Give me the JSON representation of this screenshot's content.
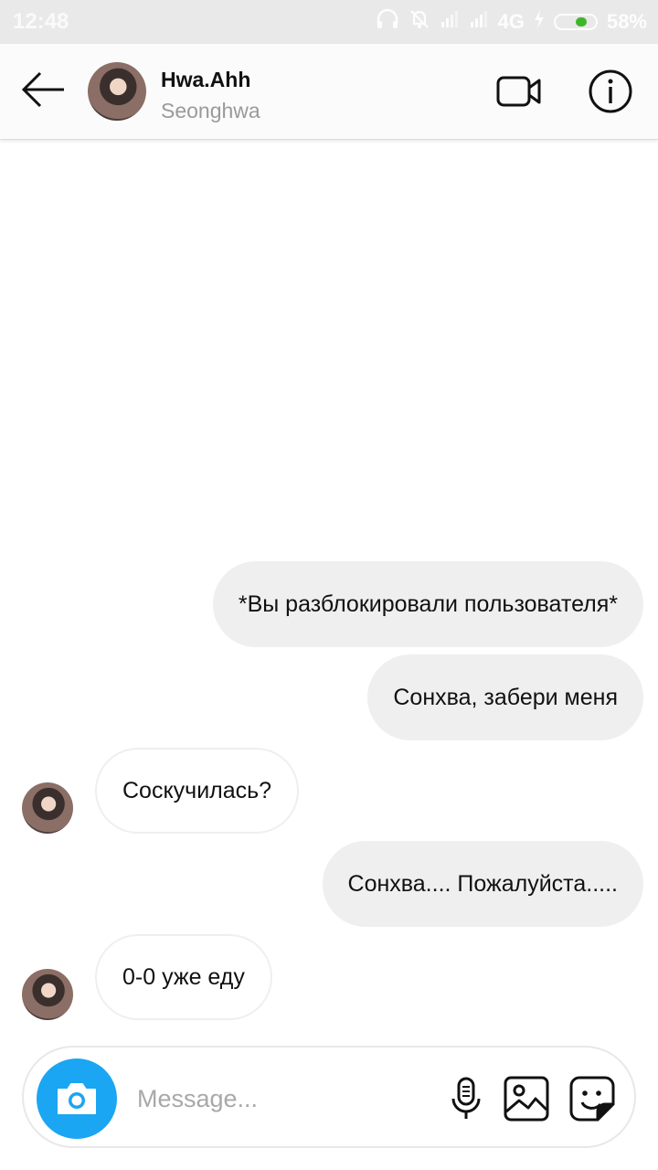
{
  "status_bar": {
    "time": "12:48",
    "network": "4G",
    "battery_percent": "58%",
    "battery_level": 0.58,
    "icons": [
      "headphones-icon",
      "bell-off-icon",
      "signal-icon",
      "signal-icon",
      "charging-icon",
      "battery-icon"
    ]
  },
  "header": {
    "username": "Hwa.Ahh",
    "display_name": "Seonghwa",
    "icons": [
      "back-arrow-icon",
      "video-call-icon",
      "info-icon"
    ]
  },
  "messages": [
    {
      "direction": "outgoing",
      "text": "*Вы разблокировали пользователя*"
    },
    {
      "direction": "outgoing",
      "text": "Сонхва, забери меня"
    },
    {
      "direction": "incoming",
      "text": "Соскучилась?"
    },
    {
      "direction": "outgoing",
      "text": "Сонхва.... Пожалуйста....."
    },
    {
      "direction": "incoming",
      "text": "0-0 уже еду"
    }
  ],
  "composer": {
    "placeholder": "Message...",
    "value": "",
    "icons": [
      "camera-icon",
      "microphone-icon",
      "gallery-icon",
      "sticker-icon"
    ]
  },
  "colors": {
    "accent": "#1aa6f2",
    "outgoing_bubble": "#efefef",
    "battery_fill": "#3fb62a"
  }
}
